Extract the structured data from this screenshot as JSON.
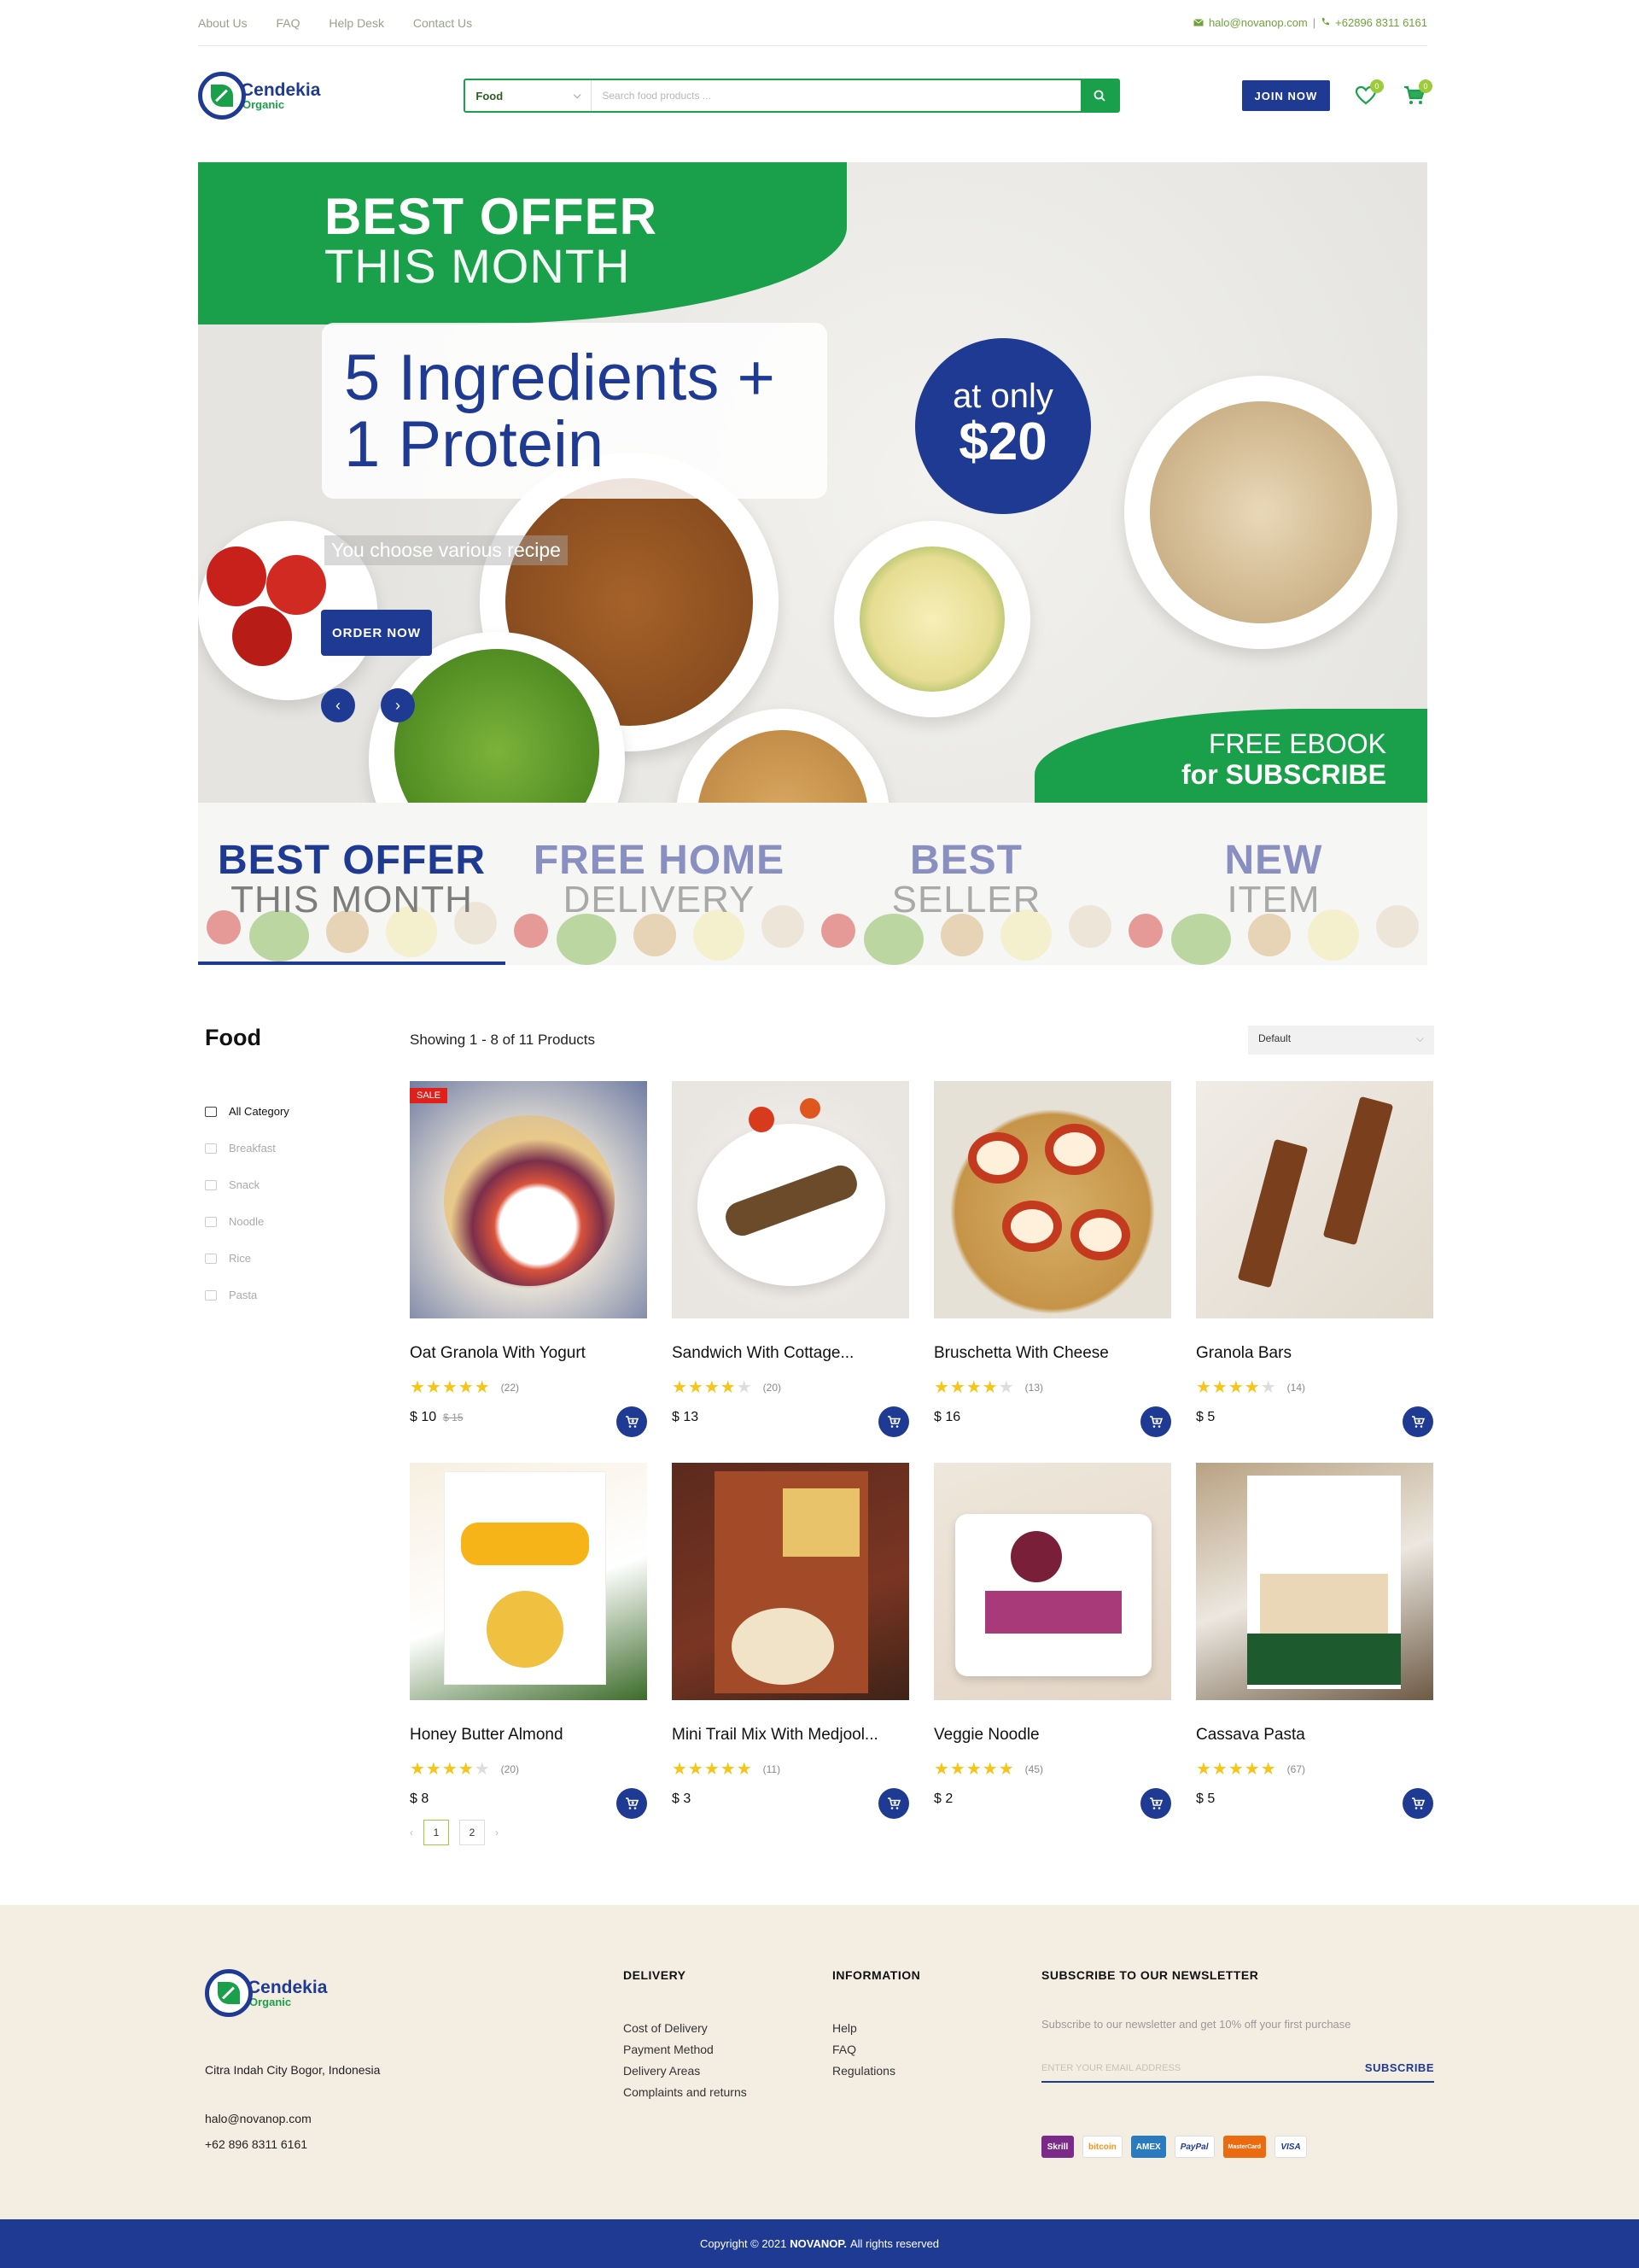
{
  "topbar": {
    "links": [
      "About Us",
      "FAQ",
      "Help Desk",
      "Contact Us"
    ],
    "email": "halo@novanop.com",
    "separator": "|",
    "phone": "+62896 8311 6161"
  },
  "header": {
    "logo_name": "Cendekia",
    "logo_sub": "Organic",
    "search_category": "Food",
    "search_placeholder": "Search food products ...",
    "join_label": "JOIN NOW",
    "wishlist_count": "0",
    "cart_count": "0"
  },
  "hero": {
    "headline_1": "BEST OFFER",
    "headline_2": "THIS MONTH",
    "offer_line_1": "5 Ingredients +",
    "offer_line_2": "1 Protein",
    "subtitle": "You choose various recipe",
    "cta": "ORDER NOW",
    "price_prefix": "at only",
    "price": "$20",
    "ebook_1": "FREE EBOOK",
    "ebook_2": "for SUBSCRIBE"
  },
  "slider_tabs": [
    {
      "a": "BEST OFFER",
      "b": "THIS MONTH",
      "active": true
    },
    {
      "a": "FREE HOME",
      "b": "DELIVERY",
      "active": false
    },
    {
      "a": "BEST",
      "b": "SELLER",
      "active": false
    },
    {
      "a": "NEW",
      "b": "ITEM",
      "active": false
    }
  ],
  "listing": {
    "title": "Food",
    "showing": "Showing 1 - 8 of 11 Products",
    "sort": "Default",
    "categories": [
      "All Category",
      "Breakfast",
      "Snack",
      "Noodle",
      "Rice",
      "Pasta"
    ]
  },
  "products": [
    {
      "name": "Oat Granola With Yogurt",
      "stars": 5,
      "count": "(22)",
      "price": "$ 10",
      "old": "$ 15",
      "sale": "SALE"
    },
    {
      "name": "Sandwich With Cottage...",
      "stars": 4,
      "count": "(20)",
      "price": "$ 13",
      "old": "",
      "sale": ""
    },
    {
      "name": "Bruschetta With Cheese",
      "stars": 4,
      "count": "(13)",
      "price": "$ 16",
      "old": "",
      "sale": ""
    },
    {
      "name": "Granola Bars",
      "stars": 4,
      "count": "(14)",
      "price": "$ 5",
      "old": "",
      "sale": ""
    },
    {
      "name": "Honey Butter Almond",
      "stars": 4,
      "count": "(20)",
      "price": "$ 8",
      "old": "",
      "sale": ""
    },
    {
      "name": "Mini Trail Mix With Medjool...",
      "stars": 5,
      "count": "(11)",
      "price": "$ 3",
      "old": "",
      "sale": ""
    },
    {
      "name": "Veggie Noodle",
      "stars": 5,
      "count": "(45)",
      "price": "$ 2",
      "old": "",
      "sale": ""
    },
    {
      "name": "Cassava Pasta",
      "stars": 5,
      "count": "(67)",
      "price": "$ 5",
      "old": "",
      "sale": ""
    }
  ],
  "pagination": {
    "prev": "‹",
    "pages": [
      "1",
      "2"
    ],
    "next": "›"
  },
  "footer": {
    "address": "Citra Indah City Bogor, Indonesia",
    "email": "halo@novanop.com",
    "phone": "+62 896 8311 6161",
    "delivery_title": "DELIVERY",
    "delivery_links": [
      "Cost of Delivery",
      "Payment Method",
      "Delivery Areas",
      "Complaints and returns"
    ],
    "info_title": "INFORMATION",
    "info_links": [
      "Help",
      "FAQ",
      "Regulations"
    ],
    "news_title": "SUBSCRIBE TO OUR NEWSLETTER",
    "news_text": "Subscribe to our newsletter and get 10% off your first purchase",
    "news_placeholder": "ENTER YOUR EMAIL ADDRESS",
    "news_button": "SUBSCRIBE",
    "payments": [
      "Skrill",
      "bitcoin",
      "AMEX",
      "PayPal",
      "MasterCard",
      "VISA"
    ]
  },
  "copyright": {
    "prefix": "Copyright © 2021",
    "brand": "NOVANOP.",
    "suffix": "All rights reserved"
  },
  "colors": {
    "brand_blue": "#1f3a93",
    "brand_green": "#1aa04a",
    "accent_lime": "#9ccc3a",
    "star": "#f5c518",
    "footer_bg": "#f4ede2"
  }
}
